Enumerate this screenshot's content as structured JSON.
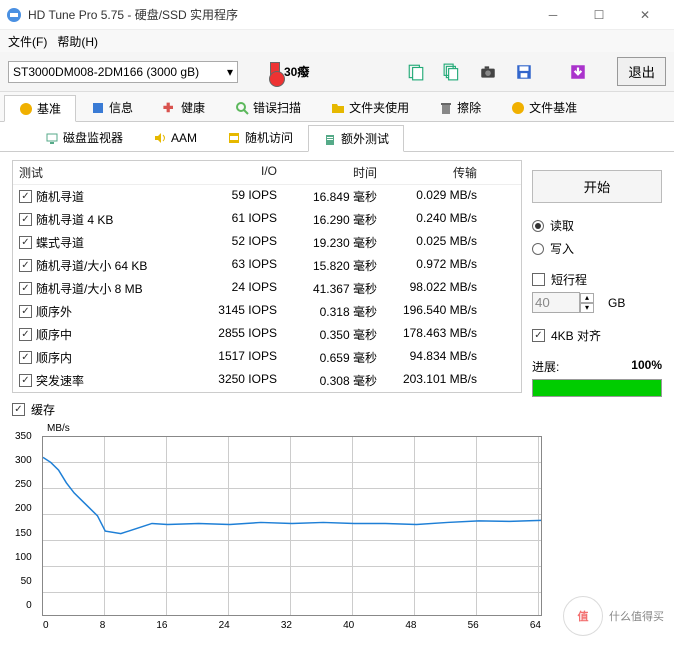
{
  "title": "HD Tune Pro 5.75 - 硬盘/SSD 实用程序",
  "menu": {
    "file": "文件(F)",
    "help": "帮助(H)"
  },
  "drive": "ST3000DM008-2DM166 (3000 gB)",
  "temp": "30癈",
  "exit": "退出",
  "tabs": [
    {
      "label": "基准",
      "color": "#f0b000"
    },
    {
      "label": "信息",
      "color": "#3a7bd5"
    },
    {
      "label": "健康",
      "color": "#d9534f"
    },
    {
      "label": "错误扫描",
      "color": "#5cb85c"
    },
    {
      "label": "文件夹使用",
      "color": "#e6b800"
    },
    {
      "label": "擦除",
      "color": "#888"
    },
    {
      "label": "文件基准",
      "color": "#f0b000"
    }
  ],
  "subtabs": [
    {
      "label": "磁盘监视器"
    },
    {
      "label": "AAM"
    },
    {
      "label": "随机访问"
    },
    {
      "label": "额外测试"
    }
  ],
  "headers": {
    "test": "测试",
    "io": "I/O",
    "time": "时间",
    "xfer": "传输"
  },
  "rows": [
    {
      "name": "随机寻道",
      "io": "59 IOPS",
      "time": "16.849 毫秒",
      "xfer": "0.029 MB/s"
    },
    {
      "name": "随机寻道 4 KB",
      "io": "61 IOPS",
      "time": "16.290 毫秒",
      "xfer": "0.240 MB/s"
    },
    {
      "name": "蝶式寻道",
      "io": "52 IOPS",
      "time": "19.230 毫秒",
      "xfer": "0.025 MB/s"
    },
    {
      "name": "随机寻道/大小 64 KB",
      "io": "63 IOPS",
      "time": "15.820 毫秒",
      "xfer": "0.972 MB/s"
    },
    {
      "name": "随机寻道/大小 8 MB",
      "io": "24 IOPS",
      "time": "41.367 毫秒",
      "xfer": "98.022 MB/s"
    },
    {
      "name": "顺序外",
      "io": "3145 IOPS",
      "time": "0.318 毫秒",
      "xfer": "196.540 MB/s"
    },
    {
      "name": "顺序中",
      "io": "2855 IOPS",
      "time": "0.350 毫秒",
      "xfer": "178.463 MB/s"
    },
    {
      "name": "顺序内",
      "io": "1517 IOPS",
      "time": "0.659 毫秒",
      "xfer": "94.834 MB/s"
    },
    {
      "name": "突发速率",
      "io": "3250 IOPS",
      "time": "0.308 毫秒",
      "xfer": "203.101 MB/s"
    }
  ],
  "cache_label": "缓存",
  "start": "开始",
  "read": "读取",
  "write": "写入",
  "short_stroke": "短行程",
  "size_val": "40",
  "size_unit": "GB",
  "align_4kb": "4KB 对齐",
  "progress_lbl": "进展:",
  "progress_val": "100%",
  "watermark": "什么值得买",
  "chart_data": {
    "type": "line",
    "title": "",
    "xlabel": "",
    "ylabel": "MB/s",
    "x": [
      0,
      1,
      2,
      3,
      4,
      5,
      6,
      7,
      8,
      10,
      12,
      14,
      16,
      20,
      24,
      28,
      32,
      36,
      40,
      44,
      48,
      52,
      56,
      60,
      64
    ],
    "values": [
      310,
      300,
      285,
      260,
      240,
      225,
      210,
      195,
      165,
      160,
      170,
      180,
      178,
      180,
      178,
      182,
      180,
      182,
      180,
      180,
      178,
      182,
      185,
      184,
      186
    ],
    "xlim": [
      0,
      64
    ],
    "ylim": [
      0,
      350
    ],
    "xticks": [
      0,
      8,
      16,
      24,
      32,
      40,
      48,
      56,
      64
    ],
    "yticks": [
      0,
      50,
      100,
      150,
      200,
      250,
      300,
      350
    ]
  }
}
